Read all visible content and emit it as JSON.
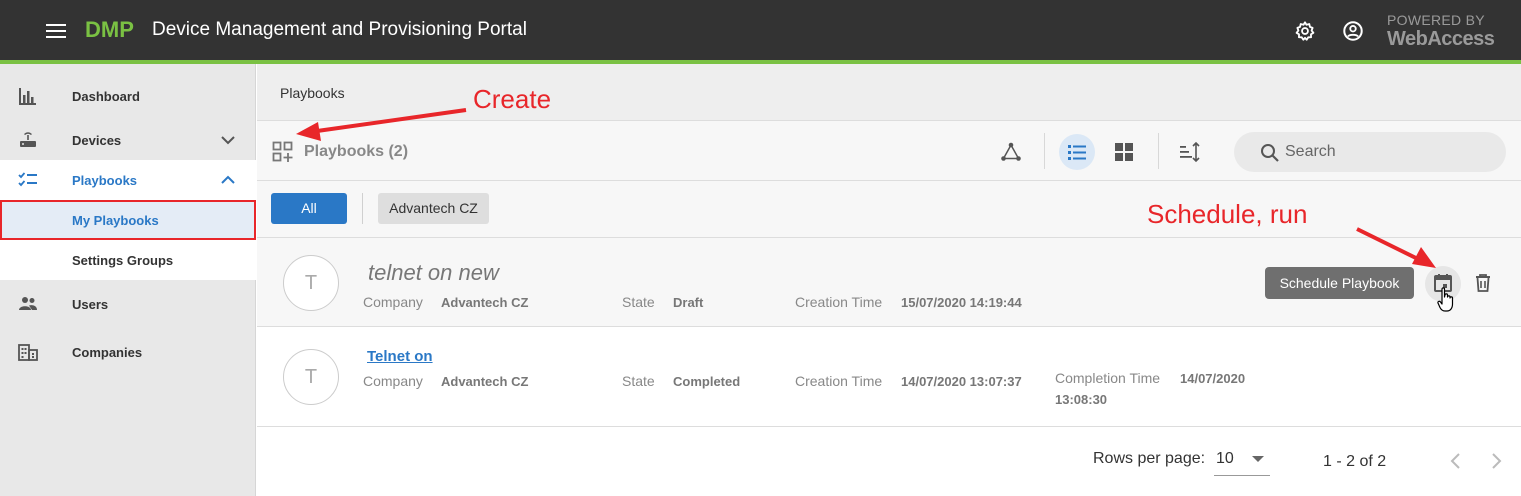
{
  "header": {
    "brand": "DMP",
    "title": "Device Management and Provisioning Portal",
    "powered_by": "POWERED BY",
    "powered_brand": "WebAccess"
  },
  "sidebar": {
    "items": [
      {
        "label": "Dashboard"
      },
      {
        "label": "Devices"
      },
      {
        "label": "Playbooks"
      },
      {
        "label": "My Playbooks"
      },
      {
        "label": "Settings Groups"
      },
      {
        "label": "Users"
      },
      {
        "label": "Companies"
      }
    ]
  },
  "breadcrumb": "Playbooks",
  "toolbar": {
    "title": "Playbooks (2)",
    "search_placeholder": "Search"
  },
  "filters": {
    "all": "All",
    "company": "Advantech CZ"
  },
  "labels": {
    "company": "Company",
    "state": "State",
    "creation_time": "Creation Time",
    "completion_time": "Completion Time"
  },
  "playbooks": [
    {
      "avatar": "T",
      "name": "telnet on new",
      "company": "Advantech CZ",
      "state": "Draft",
      "creation_time": "15/07/2020 14:19:44"
    },
    {
      "avatar": "T",
      "name": "Telnet on",
      "company": "Advantech CZ",
      "state": "Completed",
      "creation_time": "14/07/2020 13:07:37",
      "completion_time_line1": "14/07/2020",
      "completion_time_line2": "13:08:30"
    }
  ],
  "tooltip": "Schedule Playbook",
  "annotations": {
    "create": "Create",
    "schedule": "Schedule, run"
  },
  "pagination": {
    "rows_label": "Rows per page:",
    "rows_value": "10",
    "range": "1 - 2 of 2"
  },
  "colors": {
    "accent_green": "#7ac143",
    "primary_blue": "#2a78c6",
    "annotation_red": "#e8262a",
    "topbar": "#333333"
  },
  "icons": {
    "menu": "hamburger-icon",
    "settings": "gear-icon",
    "account": "account-circle-icon",
    "create": "grid-add-icon",
    "topology": "hub-icon",
    "list_view": "list-icon",
    "grid_view": "grid-icon",
    "sort": "sort-icon",
    "search": "search-icon",
    "schedule": "calendar-icon",
    "delete": "trash-icon"
  }
}
